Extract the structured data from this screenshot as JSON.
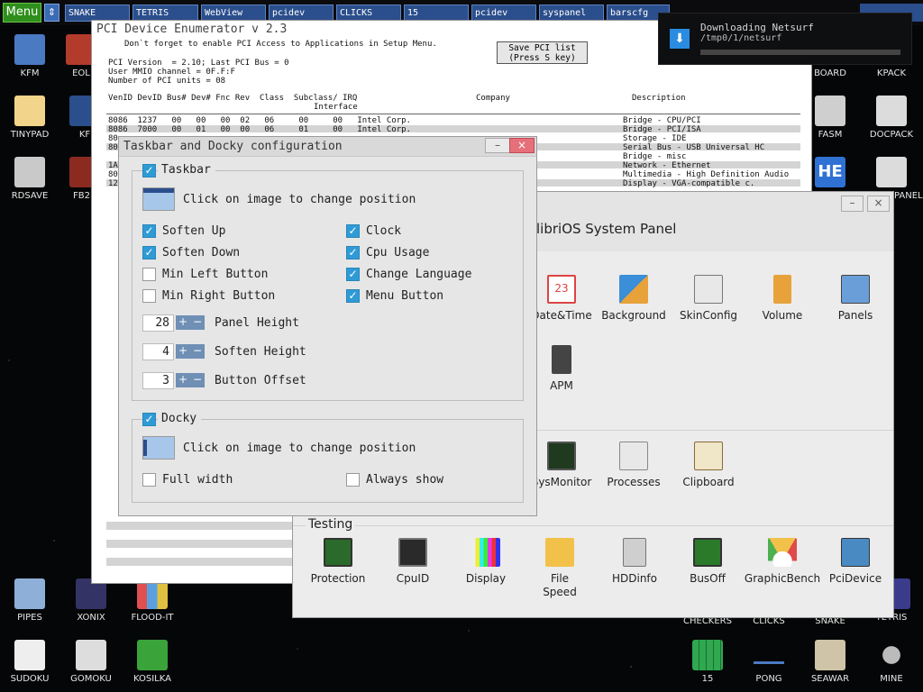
{
  "taskbar": {
    "menu_label": "Menu",
    "switch_icon": "arrows-updown-icon",
    "tasks": [
      "SNAKE",
      "TETRIS",
      "WebView",
      "pcidev",
      "CLICKS",
      "15",
      "pcidev",
      "syspanel",
      "barscfg"
    ]
  },
  "notification": {
    "title": "Downloading Netsurf",
    "path": "/tmp0/1/netsurf",
    "progress": 0.0,
    "icon": "download-arrow-icon"
  },
  "desktop": {
    "icons": [
      {
        "label": "KFM",
        "icon": "floppy-icon",
        "color": "#4a7ac2"
      },
      {
        "label": "EOL",
        "icon": "book-icon",
        "color": "#b23b2b"
      },
      {
        "label": "TINYPAD",
        "icon": "notepad-icon",
        "color": "#f2d48a"
      },
      {
        "label": "KF",
        "icon": "app-icon",
        "color": "#2b4e8c"
      },
      {
        "label": "RDSAVE",
        "icon": "ram-disk-icon",
        "color": "#c9c9c9"
      },
      {
        "label": "FB2R",
        "icon": "book-icon",
        "color": "#8a2a20"
      },
      {
        "label": "BOARD",
        "icon": "board-icon",
        "color": "#555555"
      },
      {
        "label": "KPACK",
        "icon": "pack-icon",
        "color": "#666666"
      },
      {
        "label": "FASM",
        "icon": "fasm-icon",
        "color": "#cfcfcf"
      },
      {
        "label": "DOCPACK",
        "icon": "cabinet-icon",
        "color": "#dcdcdc"
      },
      {
        "label": "HE",
        "icon": "hex-editor-icon",
        "color": "#2f72d4"
      },
      {
        "label": "PANEL",
        "icon": "sliders-icon",
        "color": "#dcdcdc"
      },
      {
        "label": "PIPES",
        "icon": "pipes-icon",
        "color": "#8eb0d8"
      },
      {
        "label": "XONIX",
        "icon": "xonix-icon",
        "color": "#333366"
      },
      {
        "label": "FLOOD-IT",
        "icon": "flood-it-icon",
        "color": "#e05050"
      },
      {
        "label": "SUDOKU",
        "icon": "sudoku-icon",
        "color": "#eeeeee"
      },
      {
        "label": "GOMOKU",
        "icon": "gomoku-icon",
        "color": "#dddddd"
      },
      {
        "label": "KOSILKA",
        "icon": "lawnmower-icon",
        "color": "#3aa33a"
      },
      {
        "label": "CHECKERS",
        "icon": "checkers-icon",
        "color": "#333333"
      },
      {
        "label": "CLICKS",
        "icon": "clicks-icon",
        "color": "#333333"
      },
      {
        "label": "SNAKE",
        "icon": "snake-icon",
        "color": "#333333"
      },
      {
        "label": "TETRIS",
        "icon": "tetris-icon",
        "color": "#3b3b8c"
      },
      {
        "label": "15",
        "icon": "fifteen-icon",
        "color": "#2fa84f"
      },
      {
        "label": "PONG",
        "icon": "pong-icon",
        "color": "#e0e0e0"
      },
      {
        "label": "SEAWAR",
        "icon": "seawar-icon",
        "color": "#cfc3a8"
      },
      {
        "label": "MINE",
        "icon": "mine-icon",
        "color": "#999999"
      }
    ]
  },
  "pci": {
    "title": "PCI Device Enumerator v 2.3",
    "note": "Don`t forget to enable PCI Access to Applications in Setup Menu.",
    "save_btn": "Save PCI list\n(Press S key)",
    "info": "PCI Version  = 2.10; Last PCI Bus = 0\nUser MMIO channel = 0F.F:F\nNumber of PCI units = 08",
    "headers": "VenID DevID Bus# Dev# Fnc Rev  Class  Subclass/ IRQ",
    "headers2": "Interface",
    "company_hdr": "Company",
    "desc_hdr": "Description",
    "rows": [
      "8086  1237   00   00   00  02   06     00     00   Intel Corp.",
      "8086  7000   00   01   00  00   06     01     00   Intel Corp.",
      "80",
      "80",
      "1A",
      "80",
      "12"
    ],
    "descriptions": [
      "Bridge - CPU/PCI",
      "Bridge - PCI/ISA",
      "Storage - IDE",
      "Serial Bus - USB Universal HC",
      "Bridge - misc",
      "Network - Ethernet",
      "Multimedia - High Definition Audio",
      "Display - VGA-compatible c."
    ]
  },
  "syspanel": {
    "title": "libriOS System Panel",
    "min_label": "–",
    "close_label": "×",
    "row1": [
      {
        "label": "Date&Time",
        "icon": "calendar-icon",
        "color": "#ffffff"
      },
      {
        "label": "Background",
        "icon": "monitor-icon",
        "color": "#3a8fd8"
      },
      {
        "label": "SkinConfig",
        "icon": "skin-window-icon",
        "color": "#e8e8e8"
      },
      {
        "label": "Volume",
        "icon": "speaker-icon",
        "color": "#e8a23a"
      },
      {
        "label": "Panels",
        "icon": "panels-icon",
        "color": "#6a9ed8"
      }
    ],
    "row2": [
      {
        "label": "APM",
        "icon": "battery-plug-icon",
        "color": "#444444"
      }
    ],
    "row3": [
      {
        "label": "SysMonitor",
        "icon": "sysmonitor-icon",
        "color": "#1f3a1f"
      },
      {
        "label": "Processes",
        "icon": "windows-icon",
        "color": "#e8e8e8"
      },
      {
        "label": "Clipboard",
        "icon": "clipboard-icon",
        "color": "#f0e6c8"
      }
    ],
    "testing_title": "Testing",
    "testing": [
      {
        "label": "Protection",
        "icon": "chip-icon",
        "color": "#2a6a2a"
      },
      {
        "label": "CpuID",
        "icon": "cpu-icon",
        "color": "#2a2a2a"
      },
      {
        "label": "Display",
        "icon": "tv-bars-icon",
        "color": "#d84a4a"
      },
      {
        "label": "File\nSpeed",
        "icon": "folder-icon",
        "color": "#f2c14a"
      },
      {
        "label": "HDDinfo",
        "icon": "hdd-icon",
        "color": "#cfcfcf"
      },
      {
        "label": "BusOff",
        "icon": "chip-green-icon",
        "color": "#2a7a2a"
      },
      {
        "label": "GraphicBench",
        "icon": "gauge-icon",
        "color": "#4caf50"
      },
      {
        "label": "PciDevice",
        "icon": "pci-card-icon",
        "color": "#4a8ac2"
      }
    ]
  },
  "config": {
    "title": "Taskbar and Docky configuration",
    "min_label": "–",
    "close_label": "×",
    "taskbar_group": "Taskbar",
    "taskbar_checked": true,
    "position_hint": "Click on image to change position",
    "left_options": [
      {
        "label": "Soften Up",
        "checked": true
      },
      {
        "label": "Soften Down",
        "checked": true
      },
      {
        "label": "Min Left Button",
        "checked": false
      },
      {
        "label": "Min Right Button",
        "checked": false
      }
    ],
    "right_options": [
      {
        "label": "Clock",
        "checked": true
      },
      {
        "label": "Cpu Usage",
        "checked": true
      },
      {
        "label": "Change Language",
        "checked": true
      },
      {
        "label": "Menu Button",
        "checked": true
      }
    ],
    "spinners": [
      {
        "value": "28",
        "label": "Panel Height"
      },
      {
        "value": "4",
        "label": "Soften Height"
      },
      {
        "value": "3",
        "label": "Button Offset"
      }
    ],
    "docky_group": "Docky",
    "docky_checked": true,
    "docky_hint": "Click on image to change position",
    "docky_options": [
      {
        "label": "Full width",
        "checked": false
      },
      {
        "label": "Always show",
        "checked": false
      }
    ]
  }
}
